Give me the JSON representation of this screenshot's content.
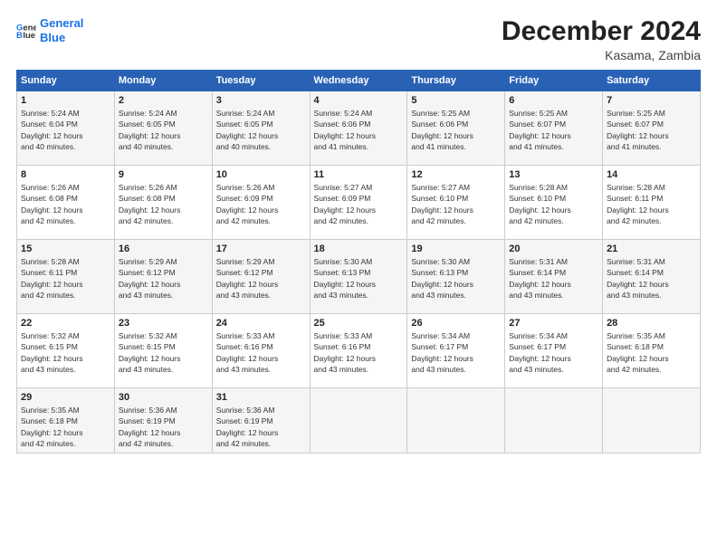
{
  "header": {
    "logo_line1": "General",
    "logo_line2": "Blue",
    "month_title": "December 2024",
    "location": "Kasama, Zambia"
  },
  "days_of_week": [
    "Sunday",
    "Monday",
    "Tuesday",
    "Wednesday",
    "Thursday",
    "Friday",
    "Saturday"
  ],
  "weeks": [
    [
      {
        "day": "1",
        "sunrise": "5:24 AM",
        "sunset": "6:04 PM",
        "daylight": "12 hours and 40 minutes."
      },
      {
        "day": "2",
        "sunrise": "5:24 AM",
        "sunset": "6:05 PM",
        "daylight": "12 hours and 40 minutes."
      },
      {
        "day": "3",
        "sunrise": "5:24 AM",
        "sunset": "6:05 PM",
        "daylight": "12 hours and 40 minutes."
      },
      {
        "day": "4",
        "sunrise": "5:24 AM",
        "sunset": "6:06 PM",
        "daylight": "12 hours and 41 minutes."
      },
      {
        "day": "5",
        "sunrise": "5:25 AM",
        "sunset": "6:06 PM",
        "daylight": "12 hours and 41 minutes."
      },
      {
        "day": "6",
        "sunrise": "5:25 AM",
        "sunset": "6:07 PM",
        "daylight": "12 hours and 41 minutes."
      },
      {
        "day": "7",
        "sunrise": "5:25 AM",
        "sunset": "6:07 PM",
        "daylight": "12 hours and 41 minutes."
      }
    ],
    [
      {
        "day": "8",
        "sunrise": "5:26 AM",
        "sunset": "6:08 PM",
        "daylight": "12 hours and 42 minutes."
      },
      {
        "day": "9",
        "sunrise": "5:26 AM",
        "sunset": "6:08 PM",
        "daylight": "12 hours and 42 minutes."
      },
      {
        "day": "10",
        "sunrise": "5:26 AM",
        "sunset": "6:09 PM",
        "daylight": "12 hours and 42 minutes."
      },
      {
        "day": "11",
        "sunrise": "5:27 AM",
        "sunset": "6:09 PM",
        "daylight": "12 hours and 42 minutes."
      },
      {
        "day": "12",
        "sunrise": "5:27 AM",
        "sunset": "6:10 PM",
        "daylight": "12 hours and 42 minutes."
      },
      {
        "day": "13",
        "sunrise": "5:28 AM",
        "sunset": "6:10 PM",
        "daylight": "12 hours and 42 minutes."
      },
      {
        "day": "14",
        "sunrise": "5:28 AM",
        "sunset": "6:11 PM",
        "daylight": "12 hours and 42 minutes."
      }
    ],
    [
      {
        "day": "15",
        "sunrise": "5:28 AM",
        "sunset": "6:11 PM",
        "daylight": "12 hours and 42 minutes."
      },
      {
        "day": "16",
        "sunrise": "5:29 AM",
        "sunset": "6:12 PM",
        "daylight": "12 hours and 43 minutes."
      },
      {
        "day": "17",
        "sunrise": "5:29 AM",
        "sunset": "6:12 PM",
        "daylight": "12 hours and 43 minutes."
      },
      {
        "day": "18",
        "sunrise": "5:30 AM",
        "sunset": "6:13 PM",
        "daylight": "12 hours and 43 minutes."
      },
      {
        "day": "19",
        "sunrise": "5:30 AM",
        "sunset": "6:13 PM",
        "daylight": "12 hours and 43 minutes."
      },
      {
        "day": "20",
        "sunrise": "5:31 AM",
        "sunset": "6:14 PM",
        "daylight": "12 hours and 43 minutes."
      },
      {
        "day": "21",
        "sunrise": "5:31 AM",
        "sunset": "6:14 PM",
        "daylight": "12 hours and 43 minutes."
      }
    ],
    [
      {
        "day": "22",
        "sunrise": "5:32 AM",
        "sunset": "6:15 PM",
        "daylight": "12 hours and 43 minutes."
      },
      {
        "day": "23",
        "sunrise": "5:32 AM",
        "sunset": "6:15 PM",
        "daylight": "12 hours and 43 minutes."
      },
      {
        "day": "24",
        "sunrise": "5:33 AM",
        "sunset": "6:16 PM",
        "daylight": "12 hours and 43 minutes."
      },
      {
        "day": "25",
        "sunrise": "5:33 AM",
        "sunset": "6:16 PM",
        "daylight": "12 hours and 43 minutes."
      },
      {
        "day": "26",
        "sunrise": "5:34 AM",
        "sunset": "6:17 PM",
        "daylight": "12 hours and 43 minutes."
      },
      {
        "day": "27",
        "sunrise": "5:34 AM",
        "sunset": "6:17 PM",
        "daylight": "12 hours and 43 minutes."
      },
      {
        "day": "28",
        "sunrise": "5:35 AM",
        "sunset": "6:18 PM",
        "daylight": "12 hours and 42 minutes."
      }
    ],
    [
      {
        "day": "29",
        "sunrise": "5:35 AM",
        "sunset": "6:18 PM",
        "daylight": "12 hours and 42 minutes."
      },
      {
        "day": "30",
        "sunrise": "5:36 AM",
        "sunset": "6:19 PM",
        "daylight": "12 hours and 42 minutes."
      },
      {
        "day": "31",
        "sunrise": "5:36 AM",
        "sunset": "6:19 PM",
        "daylight": "12 hours and 42 minutes."
      },
      null,
      null,
      null,
      null
    ]
  ]
}
